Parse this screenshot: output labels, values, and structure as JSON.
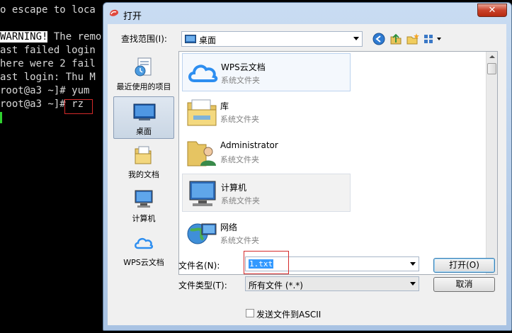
{
  "terminal": {
    "lines": [
      "o escape to loca",
      "",
      "WARNING! The remo",
      "ast failed login",
      "here were 2 fail",
      "ast login: Thu M",
      "root@a3 ~]# yum",
      "root@a3 ~]# rz"
    ],
    "warning_word": "WARNING!"
  },
  "dialog": {
    "title": "打开",
    "close_glyph": "✕",
    "look_in_label": "查找范围(I):",
    "look_in_value": "桌面",
    "places": [
      {
        "label": "最近使用的项目",
        "icon": "recent-items-icon"
      },
      {
        "label": "桌面",
        "icon": "desktop-icon",
        "selected": true
      },
      {
        "label": "我的文档",
        "icon": "documents-icon"
      },
      {
        "label": "计算机",
        "icon": "computer-icon"
      },
      {
        "label": "WPS云文档",
        "icon": "wps-cloud-icon"
      }
    ],
    "files": [
      {
        "name": "WPS云文档",
        "type": "系统文件夹",
        "icon": "wps-cloud-icon"
      },
      {
        "name": "库",
        "type": "系统文件夹",
        "icon": "library-folder-icon"
      },
      {
        "name": "Administrator",
        "type": "系统文件夹",
        "icon": "user-folder-icon"
      },
      {
        "name": "计算机",
        "type": "系统文件夹",
        "icon": "computer-icon"
      },
      {
        "name": "网络",
        "type": "系统文件夹",
        "icon": "network-icon"
      }
    ],
    "file_name_label": "文件名(N):",
    "file_name_value": "1.txt",
    "file_type_label": "文件类型(T):",
    "file_type_value": "所有文件 (*.*)",
    "open_button": "打开(O)",
    "cancel_button": "取消",
    "ascii_checkbox_label": "发送文件到ASCII",
    "ascii_checked": false
  }
}
